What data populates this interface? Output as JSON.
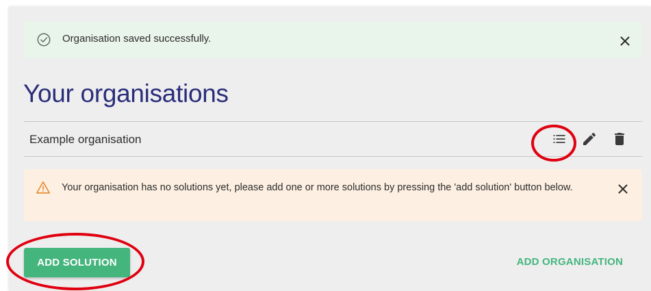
{
  "success_alert": {
    "message": "Organisation saved successfully.",
    "icon": "check-circle-icon",
    "close_icon": "close-icon",
    "color": "#e9f4ea"
  },
  "page_title": "Your organisations",
  "organisations": [
    {
      "name": "Example organisation",
      "actions": [
        "list-icon",
        "pencil-icon",
        "trash-icon"
      ]
    }
  ],
  "warning_alert": {
    "message": "Your organisation has no solutions yet, please add one or more solutions by pressing the 'add solution' button below.",
    "icon": "warning-triangle-icon",
    "close_icon": "close-icon",
    "color": "#fdf0e2"
  },
  "buttons": {
    "add_solution": "ADD SOLUTION",
    "add_organisation": "ADD ORGANISATION"
  },
  "colors": {
    "accent": "#44b57d",
    "title": "#2a2d79",
    "annotation": "#e0000f",
    "warning": "#e8862a"
  }
}
